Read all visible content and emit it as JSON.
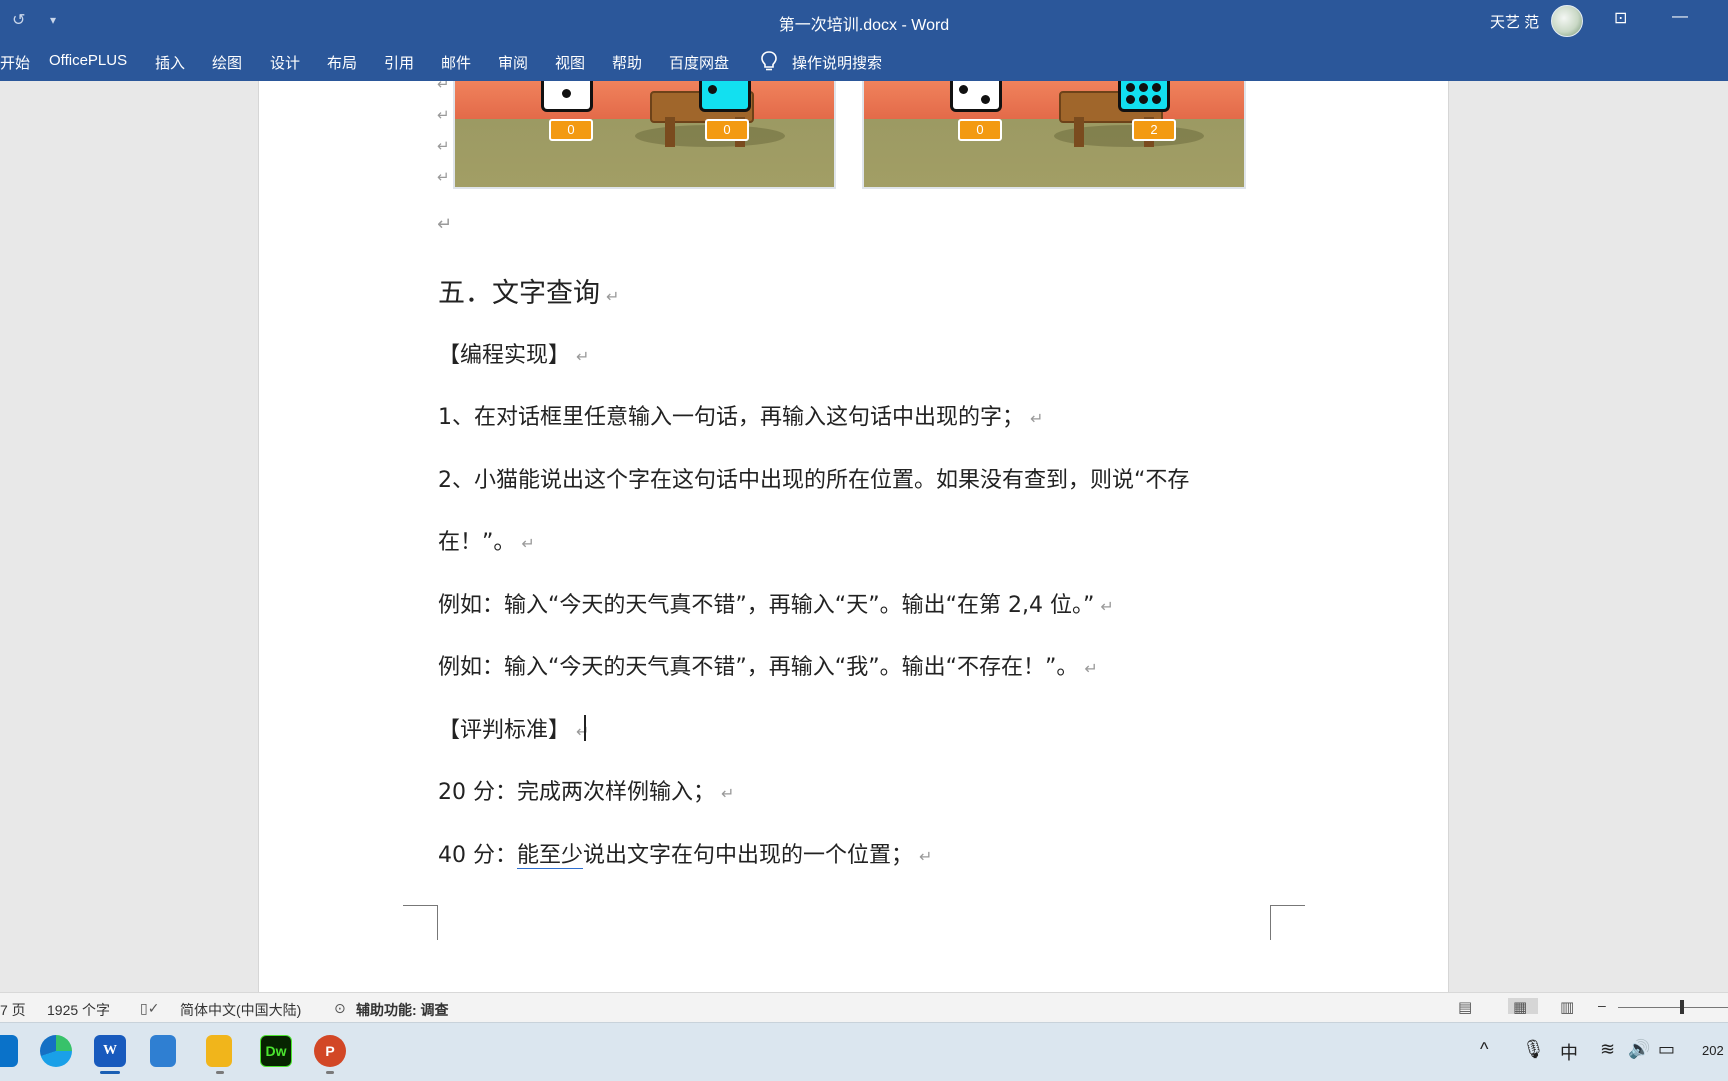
{
  "window": {
    "title": "第一次培训.docx  -  Word",
    "user_name": "天艺 范",
    "quick_access": [
      "undo-icon",
      "customize-icon"
    ],
    "controls": [
      "ribbon-display-icon",
      "minimize-icon"
    ]
  },
  "ribbon": {
    "tabs": [
      "开始",
      "OfficePLUS",
      "插入",
      "绘图",
      "设计",
      "布局",
      "引用",
      "邮件",
      "审阅",
      "视图",
      "帮助",
      "百度网盘"
    ],
    "search_label": "操作说明搜索"
  },
  "images": [
    {
      "scores": [
        "0",
        "0"
      ]
    },
    {
      "scores": [
        "0",
        "2"
      ]
    }
  ],
  "document": {
    "heading": "五．文字查询",
    "section1": "【编程实现】",
    "item1": "1、在对话框里任意输入一句话，再输入这句话中出现的字；",
    "item2_line1": "2、小猫能说出这个字在这句话中出现的所在位置。如果没有查到，则说“不存",
    "item2_line2": "在！”。",
    "example1": "例如：输入“今天的天气真不错”，再输入“天”。输出“在第 2,4 位。”",
    "example2": "例如：输入“今天的天气真不错”，再输入“我”。输出“不存在！”。",
    "section2": "【评判标准】",
    "score20": "20 分：完成两次样例输入；",
    "score40_prefix": "40 分：",
    "score40_underlined": "能至少",
    "score40_rest": "说出文字在句中出现的一个位置；",
    "paragraph_mark": "↵"
  },
  "status": {
    "page": "7 页",
    "word_count": "1925 个字",
    "language": "简体中文(中国大陆)",
    "accessibility": "辅助功能: 调查"
  },
  "taskbar": {
    "apps": [
      "edge",
      "word",
      "notepad",
      "ahk",
      "dreamweaver",
      "powerpoint"
    ],
    "dw_label": "Dw",
    "word_label": "W",
    "ppt_label": "P",
    "ime": "中",
    "clock": "202"
  }
}
